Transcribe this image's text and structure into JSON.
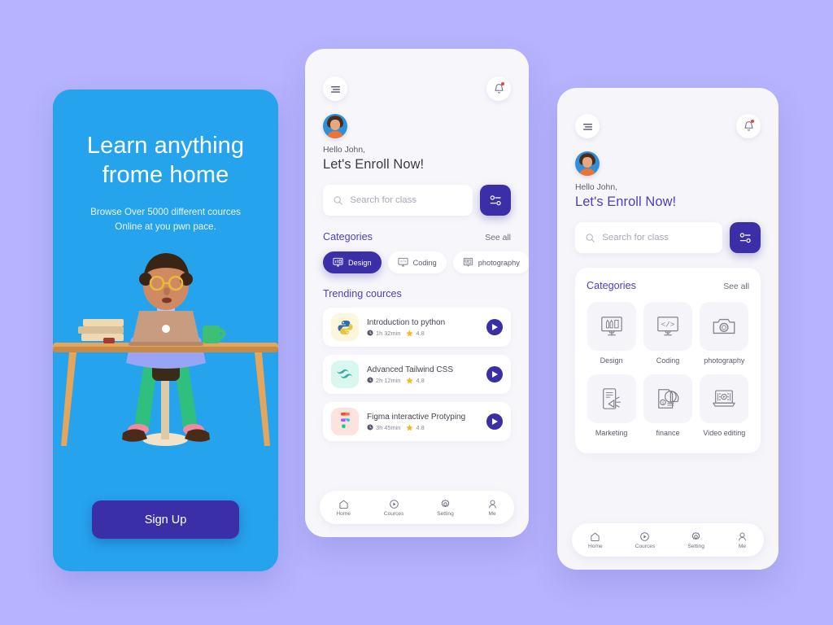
{
  "theme": {
    "page_bg": "#b6b4fe",
    "onboarding_bg": "#26a3ed",
    "primary_indigo": "#3b2fa8",
    "heading_indigo": "#4b3fbe",
    "card_white": "#ffffff",
    "phone_bg": "#f7f7fb",
    "notify_dot": "#e2483f",
    "star_yellow": "#f5b921"
  },
  "onboarding": {
    "title_line1": "Learn anything",
    "title_line2": "frome home",
    "subtitle_line1": "Browse Over 5000 different cources",
    "subtitle_line2": "Online at you pwn pace.",
    "cta_label": "Sign Up",
    "illustration": "person-at-desk-with-laptop-3d"
  },
  "home": {
    "menu_icon": "hamburger-menu-icon",
    "bell_icon": "notification-bell-icon",
    "avatar": "user-avatar",
    "greeting_small": "Hello John,",
    "greeting_big": "Let's Enroll Now!",
    "search": {
      "icon": "search-icon",
      "placeholder": "Search for class",
      "value": "",
      "filter_icon": "filter-sliders-icon"
    },
    "categories_section": {
      "title": "Categories",
      "see_all": "See all",
      "chips": [
        {
          "label": "Design",
          "icon": "design-monitor-icon",
          "active": true
        },
        {
          "label": "Coding",
          "icon": "coding-monitor-icon",
          "active": false
        },
        {
          "label": "photography",
          "icon": "photography-icon",
          "active": false
        }
      ]
    },
    "trending": {
      "title": "Trending cources",
      "courses": [
        {
          "name": "Introduction to python",
          "duration": "1h 32min",
          "rating": "4.8",
          "icon": "python-logo-icon",
          "thumb_bg": "#fdf6dc",
          "play_label": "play"
        },
        {
          "name": "Advanced Tailwind CSS",
          "duration": "2h 12min",
          "rating": "4.8",
          "icon": "tailwind-logo-icon",
          "thumb_bg": "#d9f6ef",
          "play_label": "play"
        },
        {
          "name": "Figma interactive Protyping",
          "duration": "3h 45min",
          "rating": "4.8",
          "icon": "figma-logo-icon",
          "thumb_bg": "#fde3dd",
          "play_label": "play"
        }
      ]
    },
    "bottom_nav": [
      {
        "label": "Home",
        "icon": "home-icon"
      },
      {
        "label": "Cources",
        "icon": "play-circle-icon"
      },
      {
        "label": "Setting",
        "icon": "gear-icon"
      },
      {
        "label": "Me",
        "icon": "person-icon"
      }
    ]
  },
  "categories_screen": {
    "menu_icon": "hamburger-menu-icon",
    "bell_icon": "notification-bell-icon",
    "avatar": "user-avatar",
    "greeting_small": "Hello John,",
    "greeting_big": "Let's Enroll Now!",
    "search": {
      "icon": "search-icon",
      "placeholder": "Search for class",
      "value": "",
      "filter_icon": "filter-sliders-icon"
    },
    "panel": {
      "title": "Categories",
      "see_all": "See all",
      "items": [
        {
          "label": "Design",
          "icon": "design-monitor-icon"
        },
        {
          "label": "Coding",
          "icon": "coding-monitor-icon"
        },
        {
          "label": "photography",
          "icon": "camera-icon"
        },
        {
          "label": "Marketing",
          "icon": "megaphone-phone-icon"
        },
        {
          "label": "finance",
          "icon": "pie-chart-document-icon"
        },
        {
          "label": "Video editing",
          "icon": "video-editing-laptop-icon"
        }
      ]
    },
    "bottom_nav": [
      {
        "label": "Home",
        "icon": "home-icon"
      },
      {
        "label": "Cources",
        "icon": "play-circle-icon"
      },
      {
        "label": "Setting",
        "icon": "gear-icon"
      },
      {
        "label": "Me",
        "icon": "person-icon"
      }
    ]
  }
}
